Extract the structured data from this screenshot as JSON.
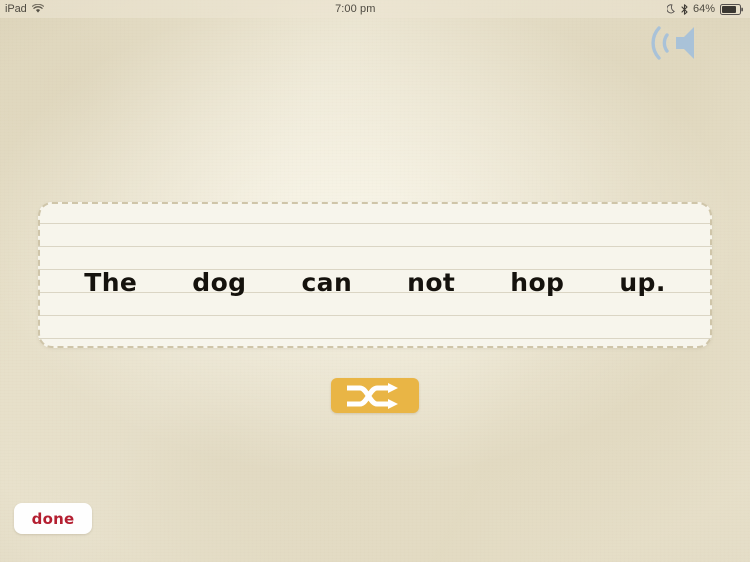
{
  "status_bar": {
    "device_label": "iPad",
    "wifi_icon": "wifi-icon",
    "time": "7:00 pm",
    "do_not_disturb_icon": "moon-icon",
    "bluetooth_icon": "bluetooth-icon",
    "battery_percent": "64%",
    "battery_icon": "battery-icon"
  },
  "toolbar": {
    "speaker_icon": "speaker-volume-icon",
    "speaker_color": "#a9c2d8"
  },
  "sentence_card": {
    "words": [
      {
        "text": "The"
      },
      {
        "text": "dog"
      },
      {
        "text": "can"
      },
      {
        "text": "not"
      },
      {
        "text": "hop"
      },
      {
        "text": "up."
      }
    ],
    "full_sentence": "The dog can not hop up.",
    "paper_color": "#f7f5ec",
    "rule_line_color": "#c4bca4",
    "border_style": "dashed",
    "border_color": "#cfc5a9"
  },
  "shuffle": {
    "icon": "shuffle-icon",
    "button_color": "#e9b545",
    "icon_color": "#ffffff"
  },
  "done": {
    "label": "done",
    "text_color": "#b41f31",
    "button_color": "#fefefe"
  },
  "background": {
    "paper_color": "#e7e0ca"
  }
}
